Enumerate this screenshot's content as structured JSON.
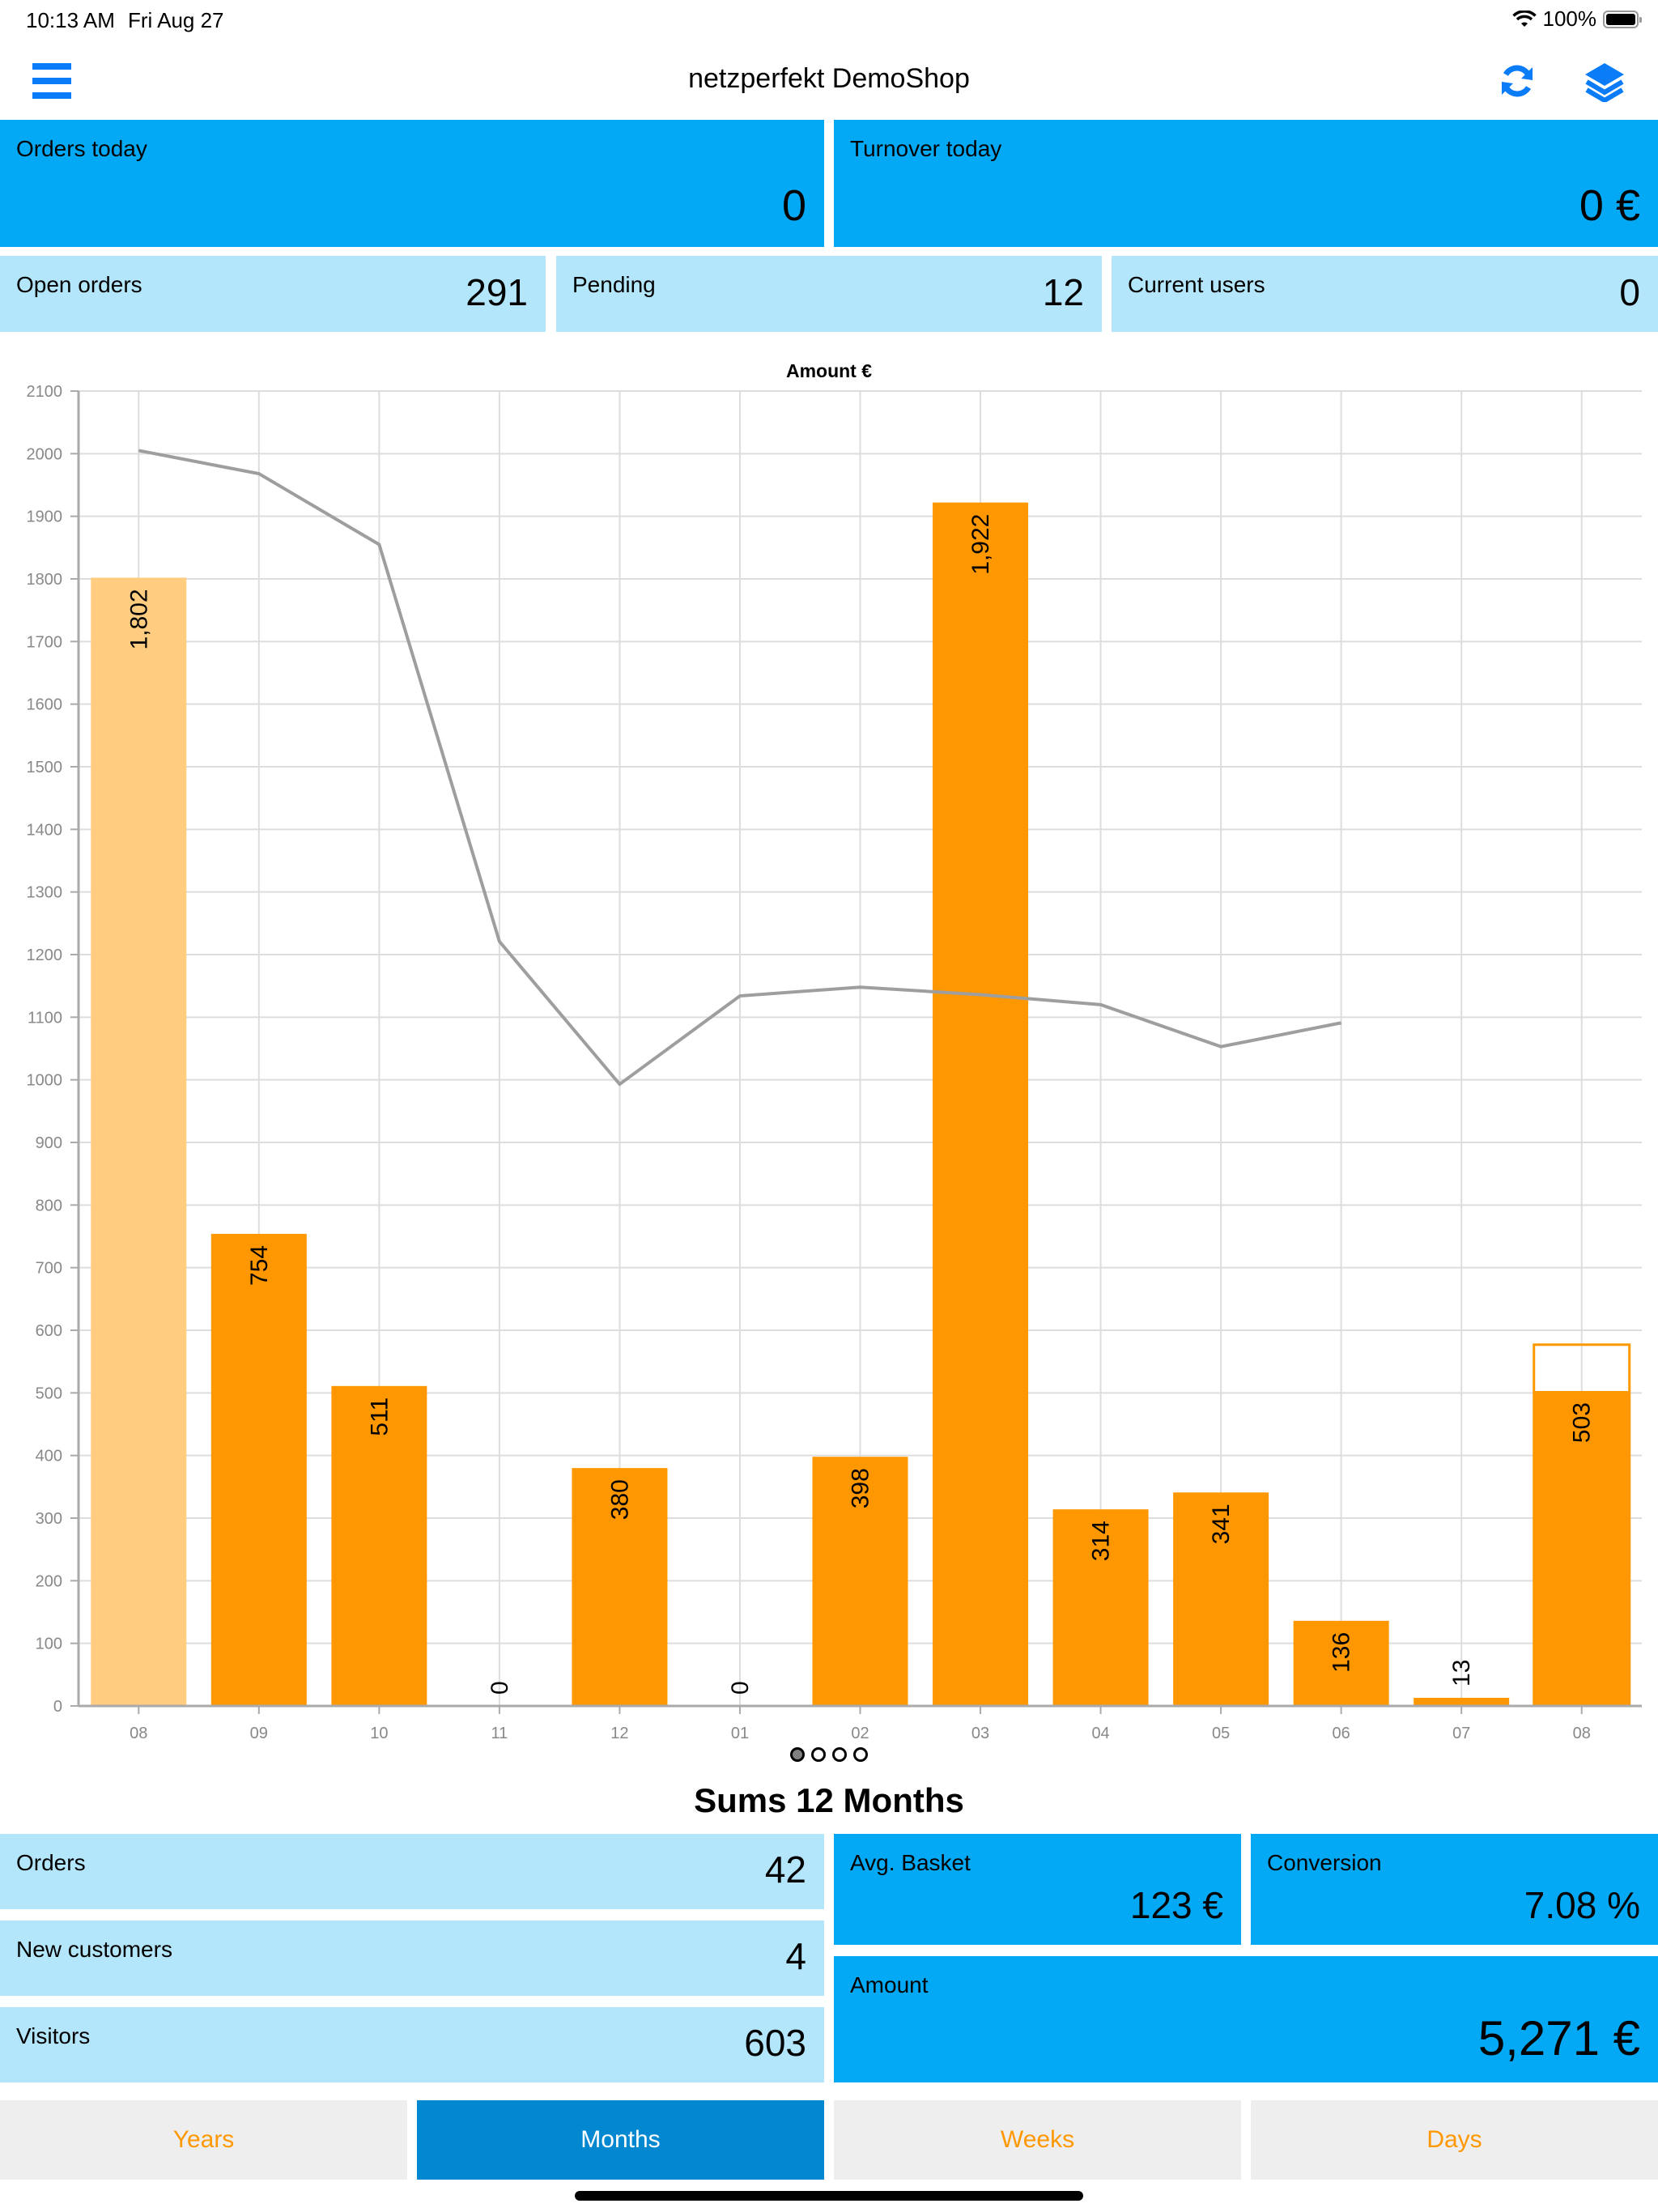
{
  "status_bar": {
    "time": "10:13 AM",
    "date": "Fri Aug 27",
    "battery": "100%"
  },
  "nav": {
    "title": "netzperfekt DemoShop",
    "icons": {
      "menu": "menu-icon",
      "refresh": "refresh-icon",
      "layers": "layers-icon"
    }
  },
  "today": [
    {
      "label": "Orders today",
      "value": "0"
    },
    {
      "label": "Turnover today",
      "value": "0 €"
    }
  ],
  "status_tiles": [
    {
      "label": "Open orders",
      "value": "291"
    },
    {
      "label": "Pending",
      "value": "12"
    },
    {
      "label": "Current users",
      "value": "0"
    }
  ],
  "chart_data": {
    "type": "bar",
    "title": "Amount €",
    "xlabel": "",
    "ylabel": "",
    "categories": [
      "08",
      "09",
      "10",
      "11",
      "12",
      "01",
      "02",
      "03",
      "04",
      "05",
      "06",
      "07",
      "08"
    ],
    "series": [
      {
        "name": "Amount",
        "kind": "bar",
        "values": [
          1802,
          754,
          511,
          0,
          380,
          0,
          398,
          1922,
          314,
          341,
          136,
          13,
          503
        ],
        "labels": [
          "1,802",
          "754",
          "511",
          "0",
          "380",
          "0",
          "398",
          "1,922",
          "314",
          "341",
          "136",
          "13",
          "503"
        ]
      },
      {
        "name": "Trend",
        "kind": "line",
        "values": [
          2005,
          1968,
          1855,
          1221,
          993,
          1134,
          1148,
          1136,
          1120,
          1053,
          1091,
          null,
          null
        ]
      }
    ],
    "projection": {
      "category_index": 12,
      "value": 577
    },
    "highlight_first_bar": true,
    "ylim": [
      0,
      2100
    ],
    "yticks": [
      0,
      100,
      200,
      300,
      400,
      500,
      600,
      700,
      800,
      900,
      1000,
      1100,
      1200,
      1300,
      1400,
      1500,
      1600,
      1700,
      1800,
      1900,
      2000,
      2100
    ],
    "grid": true,
    "colors": {
      "bar": "#ff9800",
      "bar_first": "#ffcc80",
      "line": "#9e9e9e"
    }
  },
  "pager": {
    "count": 4,
    "active": 0
  },
  "sums": {
    "title": "Sums 12 Months",
    "left": [
      {
        "label": "Orders",
        "value": "42"
      },
      {
        "label": "New customers",
        "value": "4"
      },
      {
        "label": "Visitors",
        "value": "603"
      }
    ],
    "avg_basket": {
      "label": "Avg. Basket",
      "value": "123 €"
    },
    "conversion": {
      "label": "Conversion",
      "value": "7.08 %"
    },
    "amount": {
      "label": "Amount",
      "value": "5,271 €"
    }
  },
  "tabs": [
    {
      "label": "Years",
      "active": false
    },
    {
      "label": "Months",
      "active": true
    },
    {
      "label": "Weeks",
      "active": false
    },
    {
      "label": "Days",
      "active": false
    }
  ]
}
